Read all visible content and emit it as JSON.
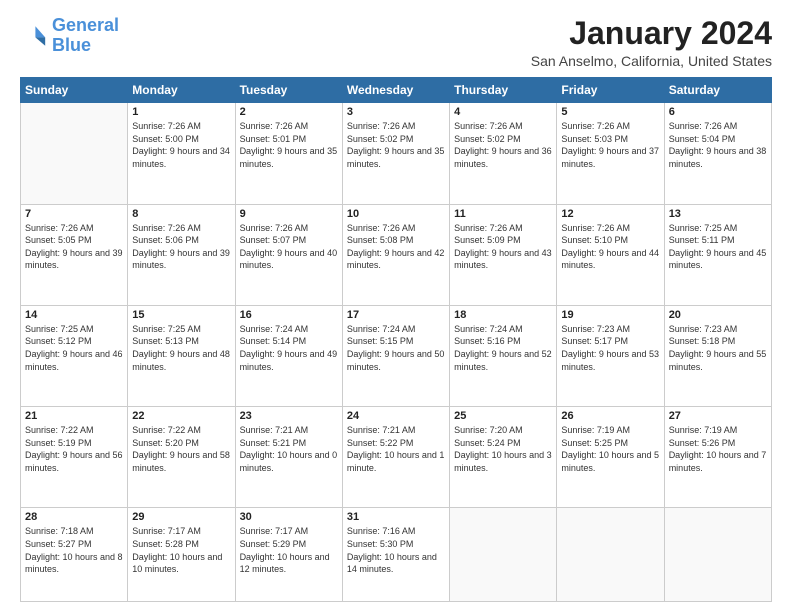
{
  "logo": {
    "line1": "General",
    "line2": "Blue"
  },
  "title": "January 2024",
  "location": "San Anselmo, California, United States",
  "header_days": [
    "Sunday",
    "Monday",
    "Tuesday",
    "Wednesday",
    "Thursday",
    "Friday",
    "Saturday"
  ],
  "weeks": [
    [
      {
        "day": "",
        "sunrise": "",
        "sunset": "",
        "daylight": ""
      },
      {
        "day": "1",
        "sunrise": "Sunrise: 7:26 AM",
        "sunset": "Sunset: 5:00 PM",
        "daylight": "Daylight: 9 hours and 34 minutes."
      },
      {
        "day": "2",
        "sunrise": "Sunrise: 7:26 AM",
        "sunset": "Sunset: 5:01 PM",
        "daylight": "Daylight: 9 hours and 35 minutes."
      },
      {
        "day": "3",
        "sunrise": "Sunrise: 7:26 AM",
        "sunset": "Sunset: 5:02 PM",
        "daylight": "Daylight: 9 hours and 35 minutes."
      },
      {
        "day": "4",
        "sunrise": "Sunrise: 7:26 AM",
        "sunset": "Sunset: 5:02 PM",
        "daylight": "Daylight: 9 hours and 36 minutes."
      },
      {
        "day": "5",
        "sunrise": "Sunrise: 7:26 AM",
        "sunset": "Sunset: 5:03 PM",
        "daylight": "Daylight: 9 hours and 37 minutes."
      },
      {
        "day": "6",
        "sunrise": "Sunrise: 7:26 AM",
        "sunset": "Sunset: 5:04 PM",
        "daylight": "Daylight: 9 hours and 38 minutes."
      }
    ],
    [
      {
        "day": "7",
        "sunrise": "Sunrise: 7:26 AM",
        "sunset": "Sunset: 5:05 PM",
        "daylight": "Daylight: 9 hours and 39 minutes."
      },
      {
        "day": "8",
        "sunrise": "Sunrise: 7:26 AM",
        "sunset": "Sunset: 5:06 PM",
        "daylight": "Daylight: 9 hours and 39 minutes."
      },
      {
        "day": "9",
        "sunrise": "Sunrise: 7:26 AM",
        "sunset": "Sunset: 5:07 PM",
        "daylight": "Daylight: 9 hours and 40 minutes."
      },
      {
        "day": "10",
        "sunrise": "Sunrise: 7:26 AM",
        "sunset": "Sunset: 5:08 PM",
        "daylight": "Daylight: 9 hours and 42 minutes."
      },
      {
        "day": "11",
        "sunrise": "Sunrise: 7:26 AM",
        "sunset": "Sunset: 5:09 PM",
        "daylight": "Daylight: 9 hours and 43 minutes."
      },
      {
        "day": "12",
        "sunrise": "Sunrise: 7:26 AM",
        "sunset": "Sunset: 5:10 PM",
        "daylight": "Daylight: 9 hours and 44 minutes."
      },
      {
        "day": "13",
        "sunrise": "Sunrise: 7:25 AM",
        "sunset": "Sunset: 5:11 PM",
        "daylight": "Daylight: 9 hours and 45 minutes."
      }
    ],
    [
      {
        "day": "14",
        "sunrise": "Sunrise: 7:25 AM",
        "sunset": "Sunset: 5:12 PM",
        "daylight": "Daylight: 9 hours and 46 minutes."
      },
      {
        "day": "15",
        "sunrise": "Sunrise: 7:25 AM",
        "sunset": "Sunset: 5:13 PM",
        "daylight": "Daylight: 9 hours and 48 minutes."
      },
      {
        "day": "16",
        "sunrise": "Sunrise: 7:24 AM",
        "sunset": "Sunset: 5:14 PM",
        "daylight": "Daylight: 9 hours and 49 minutes."
      },
      {
        "day": "17",
        "sunrise": "Sunrise: 7:24 AM",
        "sunset": "Sunset: 5:15 PM",
        "daylight": "Daylight: 9 hours and 50 minutes."
      },
      {
        "day": "18",
        "sunrise": "Sunrise: 7:24 AM",
        "sunset": "Sunset: 5:16 PM",
        "daylight": "Daylight: 9 hours and 52 minutes."
      },
      {
        "day": "19",
        "sunrise": "Sunrise: 7:23 AM",
        "sunset": "Sunset: 5:17 PM",
        "daylight": "Daylight: 9 hours and 53 minutes."
      },
      {
        "day": "20",
        "sunrise": "Sunrise: 7:23 AM",
        "sunset": "Sunset: 5:18 PM",
        "daylight": "Daylight: 9 hours and 55 minutes."
      }
    ],
    [
      {
        "day": "21",
        "sunrise": "Sunrise: 7:22 AM",
        "sunset": "Sunset: 5:19 PM",
        "daylight": "Daylight: 9 hours and 56 minutes."
      },
      {
        "day": "22",
        "sunrise": "Sunrise: 7:22 AM",
        "sunset": "Sunset: 5:20 PM",
        "daylight": "Daylight: 9 hours and 58 minutes."
      },
      {
        "day": "23",
        "sunrise": "Sunrise: 7:21 AM",
        "sunset": "Sunset: 5:21 PM",
        "daylight": "Daylight: 10 hours and 0 minutes."
      },
      {
        "day": "24",
        "sunrise": "Sunrise: 7:21 AM",
        "sunset": "Sunset: 5:22 PM",
        "daylight": "Daylight: 10 hours and 1 minute."
      },
      {
        "day": "25",
        "sunrise": "Sunrise: 7:20 AM",
        "sunset": "Sunset: 5:24 PM",
        "daylight": "Daylight: 10 hours and 3 minutes."
      },
      {
        "day": "26",
        "sunrise": "Sunrise: 7:19 AM",
        "sunset": "Sunset: 5:25 PM",
        "daylight": "Daylight: 10 hours and 5 minutes."
      },
      {
        "day": "27",
        "sunrise": "Sunrise: 7:19 AM",
        "sunset": "Sunset: 5:26 PM",
        "daylight": "Daylight: 10 hours and 7 minutes."
      }
    ],
    [
      {
        "day": "28",
        "sunrise": "Sunrise: 7:18 AM",
        "sunset": "Sunset: 5:27 PM",
        "daylight": "Daylight: 10 hours and 8 minutes."
      },
      {
        "day": "29",
        "sunrise": "Sunrise: 7:17 AM",
        "sunset": "Sunset: 5:28 PM",
        "daylight": "Daylight: 10 hours and 10 minutes."
      },
      {
        "day": "30",
        "sunrise": "Sunrise: 7:17 AM",
        "sunset": "Sunset: 5:29 PM",
        "daylight": "Daylight: 10 hours and 12 minutes."
      },
      {
        "day": "31",
        "sunrise": "Sunrise: 7:16 AM",
        "sunset": "Sunset: 5:30 PM",
        "daylight": "Daylight: 10 hours and 14 minutes."
      },
      {
        "day": "",
        "sunrise": "",
        "sunset": "",
        "daylight": ""
      },
      {
        "day": "",
        "sunrise": "",
        "sunset": "",
        "daylight": ""
      },
      {
        "day": "",
        "sunrise": "",
        "sunset": "",
        "daylight": ""
      }
    ]
  ]
}
